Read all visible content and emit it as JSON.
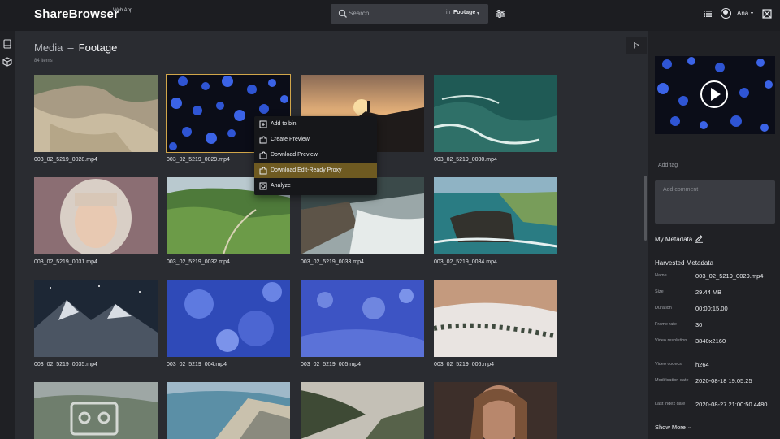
{
  "app": {
    "name": "ShareBrowser",
    "subtitle": "Web App"
  },
  "search": {
    "placeholder": "Search",
    "in_label": "in",
    "scope": "Footage",
    "caret": "▾"
  },
  "user": {
    "name": "Ana",
    "caret": "▾"
  },
  "breadcrumb": {
    "root": "Media",
    "separator": "–",
    "current": "Footage"
  },
  "item_count": "84 items",
  "collapse_label": "|>",
  "tiles": [
    {
      "caption": "003_02_5219_0028.mp4"
    },
    {
      "caption": "003_02_5219_0029.mp4"
    },
    {
      "caption": ""
    },
    {
      "caption": "003_02_5219_0030.mp4"
    },
    {
      "caption": "003_02_5219_0031.mp4"
    },
    {
      "caption": "003_02_5219_0032.mp4"
    },
    {
      "caption": "003_02_5219_0033.mp4"
    },
    {
      "caption": "003_02_5219_0034.mp4"
    },
    {
      "caption": "003_02_5219_0035.mp4"
    },
    {
      "caption": "003_02_5219_004.mp4"
    },
    {
      "caption": "003_02_5219_005.mp4"
    },
    {
      "caption": "003_02_5219_006.mp4"
    },
    {
      "caption": ""
    },
    {
      "caption": ""
    },
    {
      "caption": ""
    },
    {
      "caption": ""
    }
  ],
  "context_menu": {
    "items": [
      {
        "label": "Add to bin",
        "icon": "add-to-bin-icon"
      },
      {
        "label": "Create Preview",
        "icon": "puzzle-icon"
      },
      {
        "label": "Download Preview",
        "icon": "puzzle-icon"
      },
      {
        "label": "Download Edit-Ready Proxy",
        "icon": "puzzle-icon",
        "highlighted": true
      },
      {
        "label": "Analyze",
        "icon": "analyze-icon"
      }
    ]
  },
  "panel": {
    "add_tag": "Add tag",
    "comment_placeholder": "Add comment",
    "my_metadata": "My Metadata",
    "harvested_title": "Harvested Metadata",
    "metadata": [
      {
        "key": "Name",
        "value": "003_02_5219_0029.mp4"
      },
      {
        "key": "Size",
        "value": "29.44 MB"
      },
      {
        "key": "Duration",
        "value": "00:00:15.00"
      },
      {
        "key": "Frame rate",
        "value": "30"
      },
      {
        "key": "Video resolution",
        "value": "3840x2160"
      },
      {
        "key": "Video codecs",
        "value": "h264"
      },
      {
        "key": "Modification date",
        "value": "2020-08-18 19:05:25"
      },
      {
        "key": "Last index date",
        "value": "2020-08-27 21:00:50.4480..."
      }
    ],
    "show_more": "Show More",
    "show_more_caret": "⌄"
  },
  "colors": {
    "accent": "#d1a64a",
    "highlight": "#6e5a21",
    "topbar": "#1c1d21",
    "panel": "#202125"
  }
}
